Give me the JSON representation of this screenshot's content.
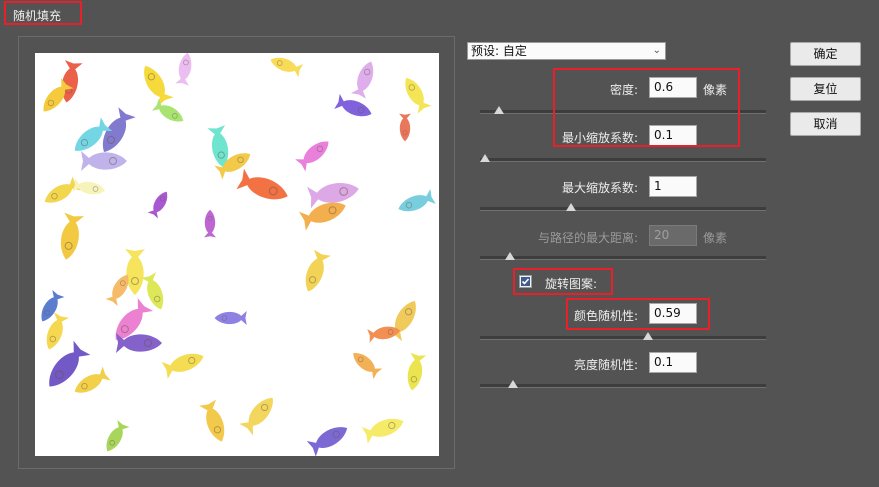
{
  "window": {
    "title": "随机填充"
  },
  "preset": {
    "label": "预设:",
    "value": "自定"
  },
  "buttons": {
    "ok": "确定",
    "reset": "复位",
    "cancel": "取消"
  },
  "params": {
    "density": {
      "label": "密度:",
      "value": "0.6",
      "unit": "像素",
      "slider": 0.05
    },
    "min_scale": {
      "label": "最小缩放系数:",
      "value": "0.1",
      "slider": 0.0
    },
    "max_scale": {
      "label": "最大缩放系数:",
      "value": "1",
      "slider": 0.31
    },
    "max_path_distance": {
      "label": "与路径的最大距离:",
      "value": "20",
      "unit": "像素",
      "disabled": true,
      "slider": 0.09
    },
    "rotate_pattern": {
      "label": "旋转图案:",
      "checked": true
    },
    "color_randomness": {
      "label": "颜色随机性:",
      "value": "0.59",
      "slider": 0.59
    },
    "brightness_randomness": {
      "label": "亮度随机性:",
      "value": "0.1",
      "slider": 0.1
    }
  },
  "colors": {
    "highlight": "#e8202a",
    "panel": "#535353"
  }
}
